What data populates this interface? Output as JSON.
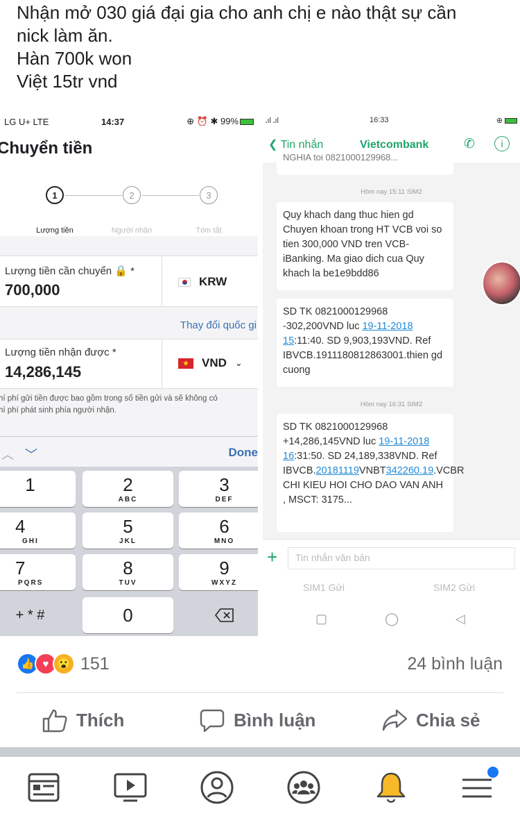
{
  "post": {
    "line1": "Nhận mở 030 giá đại gia cho anh chị e nào thật sự cần",
    "line2": "nick làm ăn.",
    "line3": "Hàn 700k won",
    "line4": "Việt 15tr vnd"
  },
  "left_phone": {
    "status": {
      "carrier": "LG U+  LTE",
      "time": "14:37",
      "right": "⊕ ⏰ ✱ 99%"
    },
    "title": "Chuyển tiền",
    "steps": [
      {
        "num": "1",
        "label": "Lượng tiền"
      },
      {
        "num": "2",
        "label": "Người nhận"
      },
      {
        "num": "3",
        "label": "Tóm tắt"
      }
    ],
    "send_label": "Lượng tiền cần chuyển 🔒 *",
    "send_value": "700,000",
    "send_currency": "KRW",
    "change_country": "Thay đổi quốc gi",
    "receive_label": "Lượng tiền nhận được  *",
    "receive_value": "14,286,145",
    "receive_currency": "VND",
    "fee_line1": "hí phí gửi tiền được bao gồm trong số tiền gửi và sẽ không có",
    "fee_line2": "hí phí phát sinh phía người nhận.",
    "done_label": "Done",
    "keys": [
      {
        "d": "1",
        "s": ""
      },
      {
        "d": "2",
        "s": "ABC"
      },
      {
        "d": "3",
        "s": "DEF"
      },
      {
        "d": "4",
        "s": "GHI"
      },
      {
        "d": "5",
        "s": "JKL"
      },
      {
        "d": "6",
        "s": "MNO"
      },
      {
        "d": "7",
        "s": "PQRS"
      },
      {
        "d": "8",
        "s": "TUV"
      },
      {
        "d": "9",
        "s": "WXYZ"
      },
      {
        "d": "+ * #",
        "s": ""
      },
      {
        "d": "0",
        "s": ""
      }
    ]
  },
  "right_phone": {
    "status": {
      "signal": "᎐ıl ᎐ıl",
      "time": "16:33"
    },
    "back_label": "Tin nhắn",
    "contact": "Vietcombank",
    "truncated": "NGHIA toi 0821000129968...",
    "time1": "Hôm nay 15:11  SIM2",
    "msg1": "Quy khach dang thuc hien gd Chuyen khoan trong HT VCB voi so tien 300,000 VND tren VCB-iBanking. Ma giao dich cua Quy khach la be1e9bdd86",
    "msg2": {
      "p1": "SD TK 0821000129968 -302,200VND luc ",
      "link1": "19-11-2018 15",
      "p2": ":11:40. SD 9,903,193VND. Ref IBVCB.1911180812863001.thien gd cuong"
    },
    "time2": "Hôm nay 16:31  SIM2",
    "msg3": {
      "p1": "SD TK 0821000129968 +14,286,145VND luc ",
      "link1": "19-11-2018 16",
      "p2": ":31:50. SD 24,189,338VND. Ref IBVCB.",
      "link2": "20181119",
      "p3": "VNBT",
      "link3": "342260.19",
      "p4": ".VCBR CHI KIEU HOI CHO DAO VAN ANH , MSCT: 3175..."
    },
    "input_placeholder": "Tin nhắn văn bản",
    "sim1_send": "SIM1 Gửi",
    "sim2_send": "SIM2 Gửi"
  },
  "footer": {
    "reaction_count": "151",
    "comments": "24 bình luận",
    "like": "Thích",
    "comment": "Bình luận",
    "share": "Chia sẻ"
  },
  "colors": {
    "fb_blue": "#1877f2",
    "vcb_green": "#1ea56a",
    "link_blue": "#1f8ad8"
  }
}
